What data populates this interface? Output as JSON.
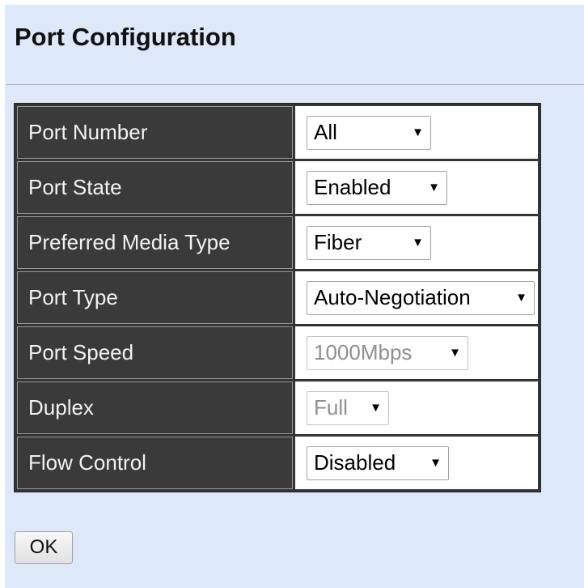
{
  "page": {
    "title": "Port Configuration"
  },
  "form": {
    "rows": [
      {
        "label": "Port Number",
        "value": "All",
        "enabled": true
      },
      {
        "label": "Port State",
        "value": "Enabled",
        "enabled": true
      },
      {
        "label": "Preferred Media Type",
        "value": "Fiber",
        "enabled": true
      },
      {
        "label": "Port Type",
        "value": "Auto-Negotiation",
        "enabled": true
      },
      {
        "label": "Port Speed",
        "value": "1000Mbps",
        "enabled": false
      },
      {
        "label": "Duplex",
        "value": "Full",
        "enabled": false
      },
      {
        "label": "Flow Control",
        "value": "Disabled",
        "enabled": true
      }
    ],
    "arrow_glyph": "▼"
  },
  "actions": {
    "ok_label": "OK"
  },
  "colors": {
    "background": "#dde9f8",
    "label_cell": "#3a3a3a",
    "table_frame": "#343434"
  }
}
